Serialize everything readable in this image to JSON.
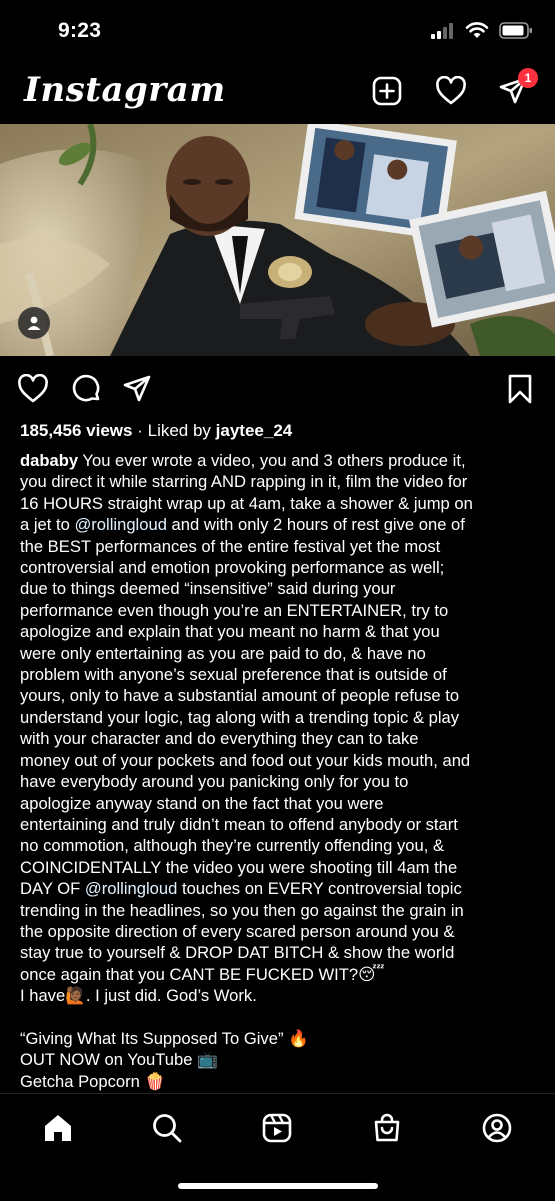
{
  "status_bar": {
    "time": "9:23"
  },
  "header": {
    "logo": "Instagram",
    "icons": [
      "new-post-icon",
      "heart-icon",
      "direct-message-icon"
    ],
    "dm_badge": "1"
  },
  "post": {
    "views": "185,456 views",
    "liked_prefix": "Liked by",
    "liked_user": "jaytee_24",
    "caption": {
      "username": "dababy",
      "line_01": "You ever wrote a video, you and 3 others produce it,",
      "line_02": "you direct it while starring AND rapping in it, film the video for",
      "line_03": "16 HOURS straight wrap up at 4am, take a shower & jump on",
      "line_04a": "a jet to ",
      "mention_1": "@rollingloud",
      "line_04b": " and with only 2 hours of rest give one of",
      "line_05": "the BEST performances of the entire festival yet the most",
      "line_06": "controversial and emotion provoking performance as well;",
      "line_07": "due to things deemed “insensitive” said during your",
      "line_08": "performance even though you’re an ENTERTAINER, try to",
      "line_09": "apologize and explain that you meant no harm & that you",
      "line_10": "were only entertaining as you are paid to do, & have no",
      "line_11": "problem with anyone’s sexual preference that is outside of",
      "line_12": "yours, only to have a substantial amount of people refuse to",
      "line_13": "understand your logic, tag along with a trending topic & play",
      "line_14": "with your character and do everything they can to take",
      "line_15": "money out of your pockets and food out your kids mouth, and",
      "line_16": "have everybody around you panicking only for you to",
      "line_17": "apologize anyway stand on the fact that you were",
      "line_18": "entertaining and truly didn’t mean to offend anybody or start",
      "line_19": "no commotion, although they’re currently offending you, &",
      "line_20": "COINCIDENTALLY the video you were shooting till 4am the",
      "line_21a": "DAY OF ",
      "mention_2": "@rollingloud",
      "line_21b": " touches on EVERY controversial topic",
      "line_22": "trending in the headlines, so you then go against the grain in",
      "line_23": "the opposite direction of every scared person around you &",
      "line_24": "stay true to yourself & DROP DAT BITCH & show the world",
      "line_25": "once again that you CANT BE FUCKED WIT?",
      "emoji_sleep": "😴",
      "line_26a": "I have",
      "emoji_raise": "🙋🏾",
      "line_26b": ". I just did. God’s Work.",
      "line_27": "“Giving What Its Supposed To Give”",
      "emoji_fire": "🔥",
      "line_28": "OUT NOW on YouTube",
      "emoji_tv": "📺",
      "line_29": "Getcha Popcorn",
      "emoji_popcorn": "🍿"
    }
  },
  "tab_bar": {
    "tabs": [
      "home-icon",
      "search-icon",
      "reels-icon",
      "shop-icon",
      "profile-icon"
    ]
  }
}
